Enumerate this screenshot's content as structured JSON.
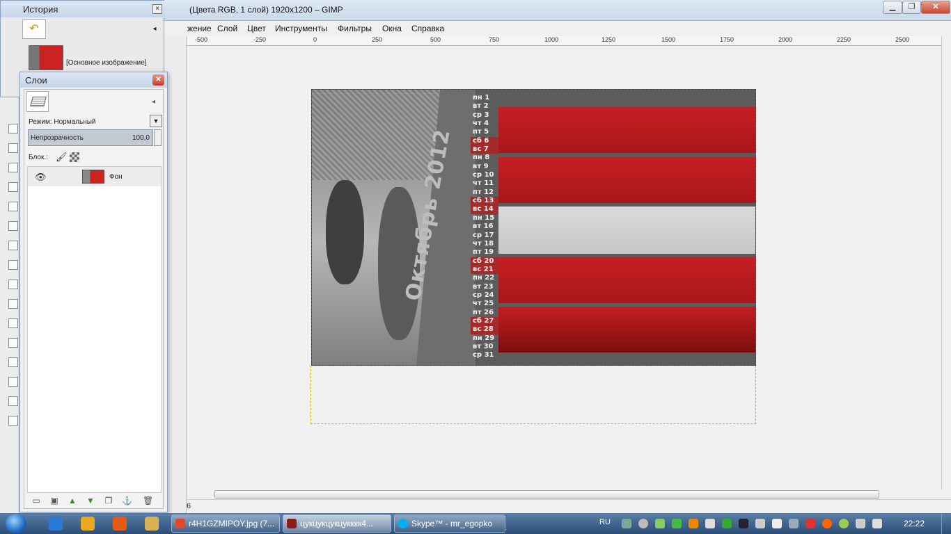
{
  "main_window": {
    "title": "(Цвета RGB, 1 слой) 1920x1200 – GIMP",
    "buttons": {
      "minimize": "▁",
      "maximize": "❐",
      "close": "✕"
    },
    "menu": [
      "жение",
      "Слой",
      "Цвет",
      "Инструменты",
      "Фильтры",
      "Окна",
      "Справка"
    ],
    "ruler_labels": [
      "-500",
      "-250",
      "0",
      "250",
      "500",
      "750",
      "1000",
      "1250",
      "1500",
      "1750",
      "2000",
      "2250",
      "2500"
    ],
    "status_text": "6"
  },
  "image": {
    "month_title": "Октябрь 2012",
    "days": [
      {
        "label": "пн 1",
        "weekend": false
      },
      {
        "label": "вт 2",
        "weekend": false
      },
      {
        "label": "ср 3",
        "weekend": false
      },
      {
        "label": "чт 4",
        "weekend": false
      },
      {
        "label": "пт 5",
        "weekend": false
      },
      {
        "label": "сб 6",
        "weekend": true
      },
      {
        "label": "вс 7",
        "weekend": true
      },
      {
        "label": "пн 8",
        "weekend": false
      },
      {
        "label": "вт 9",
        "weekend": false
      },
      {
        "label": "ср 10",
        "weekend": false
      },
      {
        "label": "чт 11",
        "weekend": false
      },
      {
        "label": "пт 12",
        "weekend": false
      },
      {
        "label": "сб 13",
        "weekend": true
      },
      {
        "label": "вс 14",
        "weekend": true
      },
      {
        "label": "пн 15",
        "weekend": false
      },
      {
        "label": "вт 16",
        "weekend": false
      },
      {
        "label": "ср 17",
        "weekend": false
      },
      {
        "label": "чт 18",
        "weekend": false
      },
      {
        "label": "пт 19",
        "weekend": false
      },
      {
        "label": "сб 20",
        "weekend": true
      },
      {
        "label": "вс 21",
        "weekend": true
      },
      {
        "label": "пн 22",
        "weekend": false
      },
      {
        "label": "вт 23",
        "weekend": false
      },
      {
        "label": "ср 24",
        "weekend": false
      },
      {
        "label": "чт 25",
        "weekend": false
      },
      {
        "label": "пт 26",
        "weekend": false
      },
      {
        "label": "сб 27",
        "weekend": true
      },
      {
        "label": "вс 28",
        "weekend": true
      },
      {
        "label": "пн 29",
        "weekend": false
      },
      {
        "label": "вт 30",
        "weekend": false
      },
      {
        "label": "ср 31",
        "weekend": false
      }
    ],
    "colors": {
      "red": "#c71f24",
      "grey_band": "#d4d4d4",
      "weekend": "#a52a2a"
    }
  },
  "history": {
    "title": "История",
    "item_label": "[Основное изображение]"
  },
  "layers": {
    "title": "Слои",
    "mode_label": "Режим: Нормальный",
    "opacity_label": "Непрозрачность",
    "opacity_value": "100,0",
    "lock_label": "Блок.:",
    "layer_name": "Фон",
    "footer_icons": [
      "new-layer-icon",
      "new-group-icon",
      "raise-icon",
      "lower-icon",
      "duplicate-icon",
      "anchor-icon",
      "delete-icon"
    ]
  },
  "taskbar": {
    "tasks": [
      {
        "label": "r4H1GZMIPOY.jpg (7...",
        "icon_color": "#e04a2b",
        "active": false
      },
      {
        "label": "цукцукцукцукккк4...",
        "icon_color": "#8a1c1c",
        "active": true
      },
      {
        "label": "Skype™ - mr_egopko",
        "icon_color": "#00aff0",
        "active": false
      }
    ],
    "lang": "RU",
    "clock": "22:22"
  }
}
